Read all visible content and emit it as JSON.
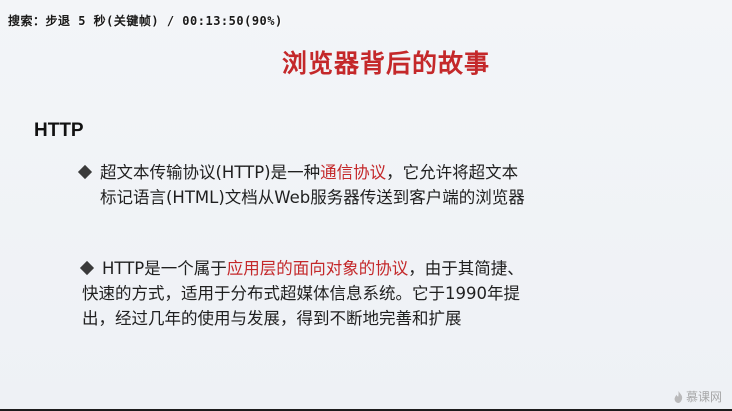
{
  "overlay": {
    "seek_text": "搜索：步退 5 秒(关键帧) / 00:13:50(90%)"
  },
  "slide": {
    "title": "浏览器背后的故事",
    "section_heading": "HTTP",
    "bullets": [
      {
        "lines": [
          {
            "pre": "超文本传输协议(HTTP)是一种",
            "hl": "通信协议",
            "post": "，它允许将超文本"
          },
          {
            "pre": "标记语言(HTML)文档从Web服务器传送到客户端的浏览器",
            "hl": "",
            "post": ""
          }
        ]
      },
      {
        "lines": [
          {
            "pre": "HTTP是一个属于",
            "hl": "应用层的面向对象的协议",
            "post": "，由于其简捷、"
          },
          {
            "pre": "快速的方式，适用于分布式超媒体信息系统。它于1990年提",
            "hl": "",
            "post": ""
          },
          {
            "pre": "出，经过几年的使用与发展，得到不断地完善和扩展",
            "hl": "",
            "post": ""
          }
        ]
      }
    ],
    "highlight_color": "#c4282a"
  },
  "watermark": {
    "text": "慕课网",
    "icon": "flame-icon"
  }
}
